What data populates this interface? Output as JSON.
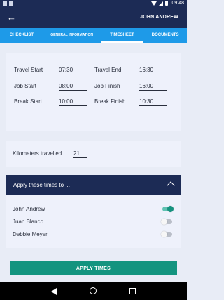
{
  "status_bar": {
    "time": "09:48"
  },
  "header": {
    "user_name": "JOHN ANDREW"
  },
  "tabs": [
    {
      "label": "CHECKLIST",
      "active": false
    },
    {
      "label": "GENERAL INFORMATION",
      "active": false
    },
    {
      "label": "TIMESHEET",
      "active": true
    },
    {
      "label": "DOCUMENTS",
      "active": false
    }
  ],
  "times": {
    "travel_start_label": "Travel Start",
    "travel_start_value": "07:30",
    "travel_end_label": "Travel End",
    "travel_end_value": "16:30",
    "job_start_label": "Job Start",
    "job_start_value": "08:00",
    "job_finish_label": "Job Finish",
    "job_finish_value": "16:00",
    "break_start_label": "Break Start",
    "break_start_value": "10:00",
    "break_finish_label": "Break Finish",
    "break_finish_value": "10:30"
  },
  "km": {
    "label": "Kilometers travelled",
    "value": "21"
  },
  "apply_section": {
    "title": "Apply these times to ...",
    "people": [
      {
        "name": "John Andrew",
        "enabled": true
      },
      {
        "name": "Juan Blanco",
        "enabled": false
      },
      {
        "name": "Debbie Meyer",
        "enabled": false
      }
    ]
  },
  "apply_button": "APPLY TIMES",
  "colors": {
    "primary_dark": "#1c2b55",
    "tab_blue": "#1e9ae8",
    "accent_teal": "#13947f"
  }
}
